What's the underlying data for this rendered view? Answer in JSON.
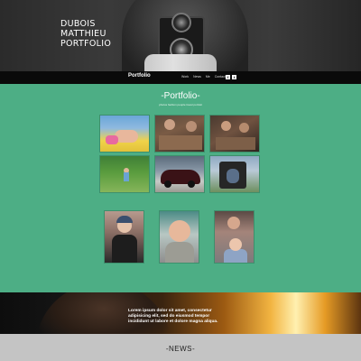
{
  "hero": {
    "title_lines": [
      "DUBOIS",
      "MATTHIEU",
      "PORTFOLIO"
    ]
  },
  "navbar": {
    "brand": "Portfolio",
    "links": [
      "Work",
      "News",
      "Me",
      "Contact"
    ],
    "social": [
      {
        "label": "f",
        "icon": "facebook-icon"
      },
      {
        "label": "t",
        "icon": "twitter-icon"
      }
    ]
  },
  "portfolio": {
    "title": "-Portfolio-",
    "subtitle": "photos fashion people travel portrait",
    "background": "#4dae85"
  },
  "banner": {
    "text": "Lorem ipsum dolor sit amet, consectetur adipisicing elit, sed do eiusmod tempor incididunt ut labore et dolore magna aliqua."
  },
  "news": {
    "title": "-NEWS-"
  }
}
